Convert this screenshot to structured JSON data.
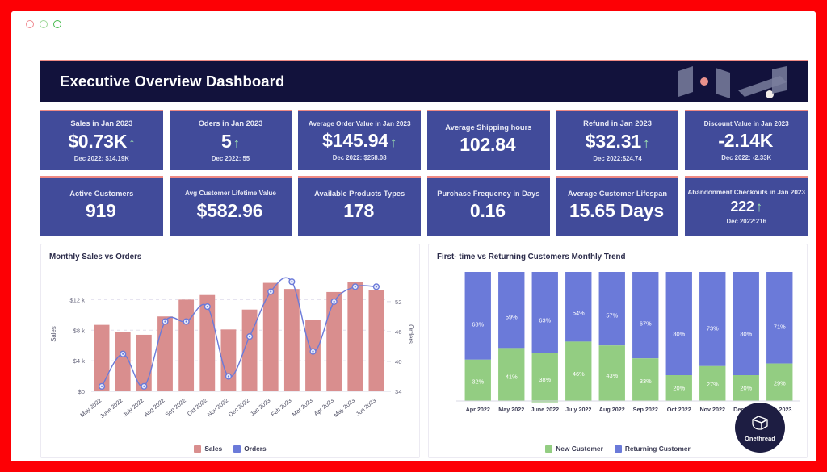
{
  "window": {
    "dots": [
      "close-dot",
      "minimize-dot",
      "maximize-dot"
    ]
  },
  "header": {
    "title": "Executive Overview Dashboard",
    "background": "#12123c",
    "accent": "#ef8a84"
  },
  "colors": {
    "kpi_card": "#414b9a",
    "kpi_accent": "#ef8a84",
    "sales_bar": "#d98e8e",
    "orders_line": "#6b7ad9",
    "new_customer": "#93cd82",
    "returning_customer": "#6b7ad9",
    "frame_red": "#fd0005"
  },
  "kpis": {
    "row1": [
      {
        "label": "Sales in Jan 2023",
        "value": "$0.73K",
        "arrow": "↑",
        "sub": "Dec 2022: $14.19K"
      },
      {
        "label": "Oders in Jan 2023",
        "value": "5",
        "arrow": "↑",
        "sub": "Dec 2022: 55"
      },
      {
        "label": "Average Order Value in Jan 2023",
        "value": "$145.94",
        "arrow": "↑",
        "sub": "Dec 2022: $258.08"
      },
      {
        "label": "Average Shipping hours",
        "value": "102.84",
        "arrow": "",
        "sub": ""
      },
      {
        "label": "Refund in Jan 2023",
        "value": "$32.31",
        "arrow": "↑",
        "sub": "Dec 2022:$24.74"
      },
      {
        "label": "Discount Value in Jan 2023",
        "value": "-2.14K",
        "arrow": "",
        "sub": "Dec 2022:  -2.33K"
      }
    ],
    "row2": [
      {
        "label": "Active Customers",
        "value": "919",
        "arrow": "",
        "sub": ""
      },
      {
        "label": "Avg Customer Lifetime Value",
        "value": "$582.96",
        "arrow": "",
        "sub": ""
      },
      {
        "label": "Available Products Types",
        "value": "178",
        "arrow": "",
        "sub": ""
      },
      {
        "label": "Purchase Frequency in Days",
        "value": "0.16",
        "arrow": "",
        "sub": ""
      },
      {
        "label": "Average Customer Lifespan",
        "value": "15.65 Days",
        "arrow": "",
        "sub": ""
      },
      {
        "label": "Abandonment Checkouts in Jan 2023",
        "value": "222",
        "arrow": "↑",
        "sub": "Dec 2022:216"
      }
    ]
  },
  "chart_data": [
    {
      "type": "bar",
      "id": "monthly-sales-vs-orders",
      "title": "Monthly Sales vs Orders",
      "categories": [
        "May 2022",
        "June 2022",
        "July 2022",
        "Aug 2022",
        "Sep 2022",
        "Oct 2022",
        "Nov 2022",
        "Dec 2022",
        "Jan 2023",
        "Feb 2023",
        "Mar 2023",
        "Apr 2023",
        "May 2023",
        "Jun 2023"
      ],
      "series": [
        {
          "name": "Sales",
          "type": "bar",
          "axis": "left",
          "values": [
            8700,
            7800,
            7400,
            9800,
            12000,
            12600,
            8100,
            10700,
            14200,
            13400,
            9300,
            13000,
            14300,
            13300
          ]
        },
        {
          "name": "Orders",
          "type": "line",
          "axis": "right",
          "values": [
            35,
            41.5,
            35,
            48,
            48,
            51,
            37,
            45,
            54,
            56,
            42,
            52,
            55,
            55
          ]
        }
      ],
      "xlabel": "",
      "ylabel": "Sales",
      "y2label": "Orders",
      "yticks": [
        "$0",
        "$4 k",
        "$8 k",
        "$12 k"
      ],
      "ytick_values": [
        0,
        4000,
        8000,
        12000
      ],
      "ylim": [
        0,
        15000
      ],
      "y2ticks": [
        "34",
        "40",
        "46",
        "52"
      ],
      "y2tick_values": [
        34,
        40,
        46,
        52
      ],
      "y2lim": [
        34,
        57
      ],
      "grid": true,
      "legend": [
        "Sales",
        "Orders"
      ],
      "legend_position": "bottom"
    },
    {
      "type": "bar",
      "id": "first-time-vs-returning",
      "title": "First- time vs Returning  Customers Monthly Trend",
      "stacked": true,
      "stack_mode": "percent",
      "categories": [
        "Apr 2022",
        "May 2022",
        "June 2022",
        "July 2022",
        "Aug 2022",
        "Sep 2022",
        "Oct 2022",
        "Nov 2022",
        "Dec 2022",
        "Jan 2023"
      ],
      "series": [
        {
          "name": "New Customer",
          "values": [
            32,
            41,
            38,
            46,
            43,
            33,
            20,
            27,
            20,
            29
          ],
          "labels": [
            "32%",
            "41%",
            "38%",
            "46%",
            "43%",
            "33%",
            "20%",
            "27%",
            "20%",
            "29%"
          ]
        },
        {
          "name": "Returning Customer",
          "values": [
            68,
            59,
            63,
            54,
            57,
            67,
            80,
            73,
            80,
            71
          ],
          "labels": [
            "68%",
            "59%",
            "63%",
            "54%",
            "57%",
            "67%",
            "80%",
            "73%",
            "80%",
            "71%"
          ]
        }
      ],
      "xlabel": "",
      "ylabel": "",
      "ylim": [
        0,
        100
      ],
      "grid": false,
      "legend": [
        "New Customer",
        "Returning Customer"
      ],
      "legend_position": "bottom"
    }
  ],
  "branding": {
    "badge_text": "Onethread"
  }
}
